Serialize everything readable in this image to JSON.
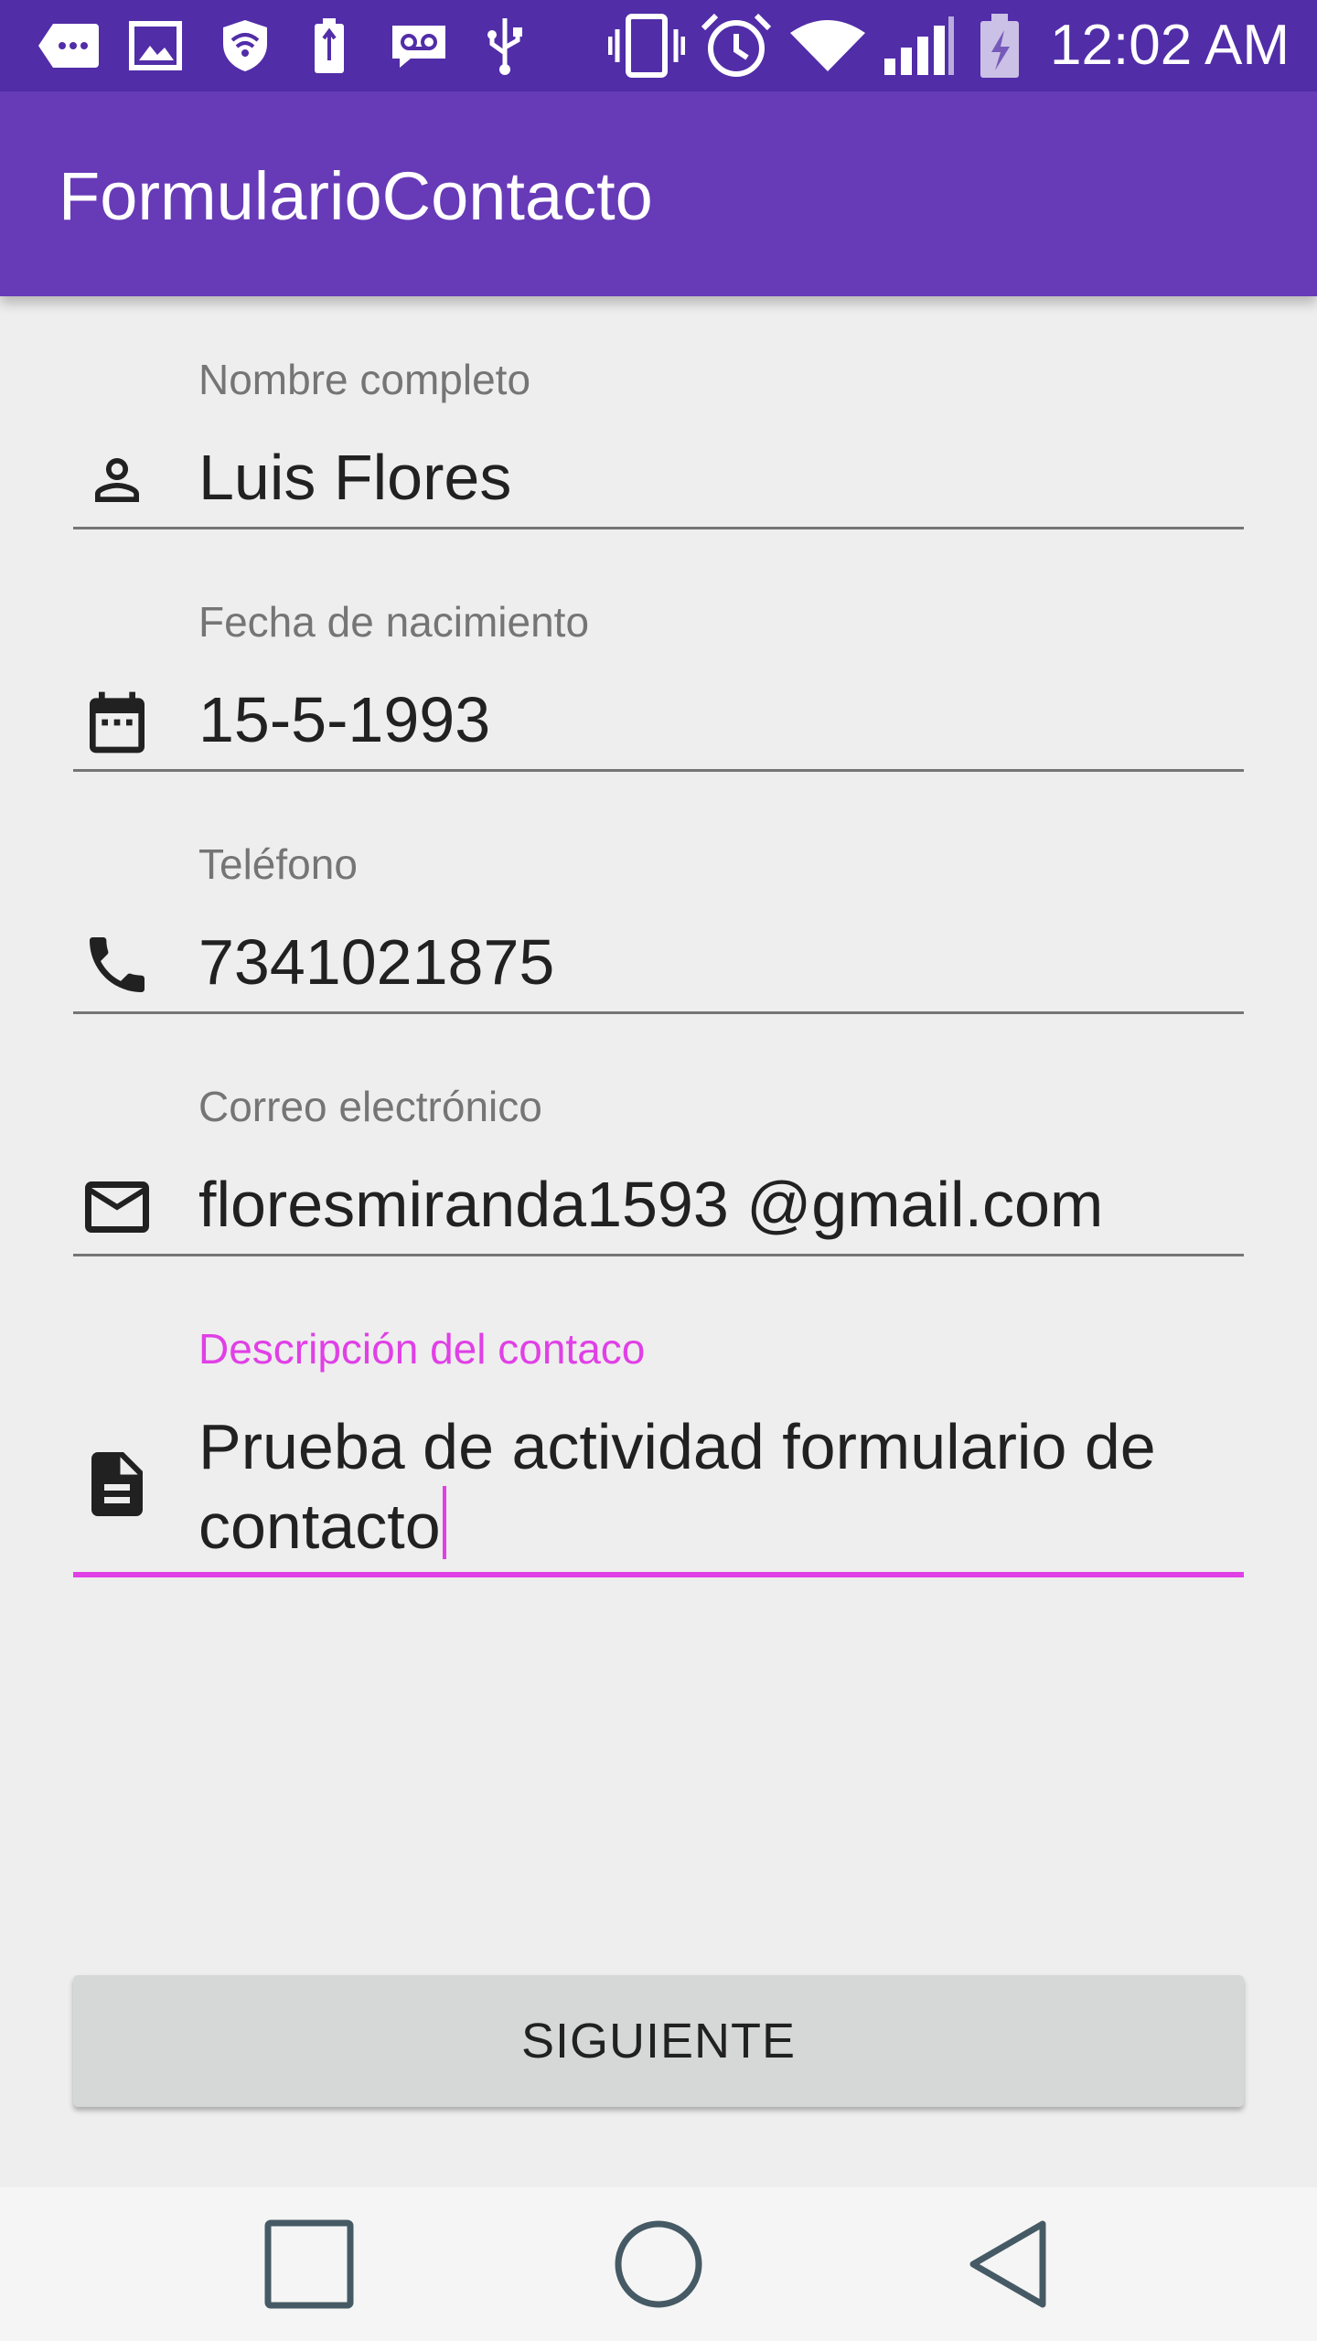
{
  "status_bar": {
    "time": "12:02 AM",
    "icons": [
      "notification-dots-icon",
      "image-icon",
      "shield-wifi-icon",
      "battery-usb-icon",
      "voicemail-icon",
      "usb-icon",
      "vibrate-icon",
      "alarm-icon",
      "wifi-icon",
      "signal-icon",
      "battery-charging-icon"
    ]
  },
  "app_bar": {
    "title": "FormularioContacto"
  },
  "form": {
    "fields": [
      {
        "label": "Nombre completo",
        "value": "Luis Flores",
        "icon": "person-icon"
      },
      {
        "label": "Fecha de nacimiento",
        "value": "15-5-1993",
        "icon": "calendar-icon"
      },
      {
        "label": "Teléfono",
        "value": "7341021875",
        "icon": "phone-icon"
      },
      {
        "label": "Correo electrónico",
        "value": "floresmiranda1593 @gmail.com",
        "icon": "mail-icon"
      },
      {
        "label": "Descripción del contaco",
        "value": "Prueba de actividad formulario de contacto",
        "icon": "document-icon"
      }
    ],
    "next_button": "SIGUIENTE"
  },
  "nav_bar": {
    "buttons": [
      "recents-square-icon",
      "home-circle-icon",
      "back-triangle-icon"
    ]
  },
  "colors": {
    "status_bar": "#512da8",
    "app_bar": "#673ab7",
    "accent": "#e040e6",
    "background": "#eeeeee"
  }
}
